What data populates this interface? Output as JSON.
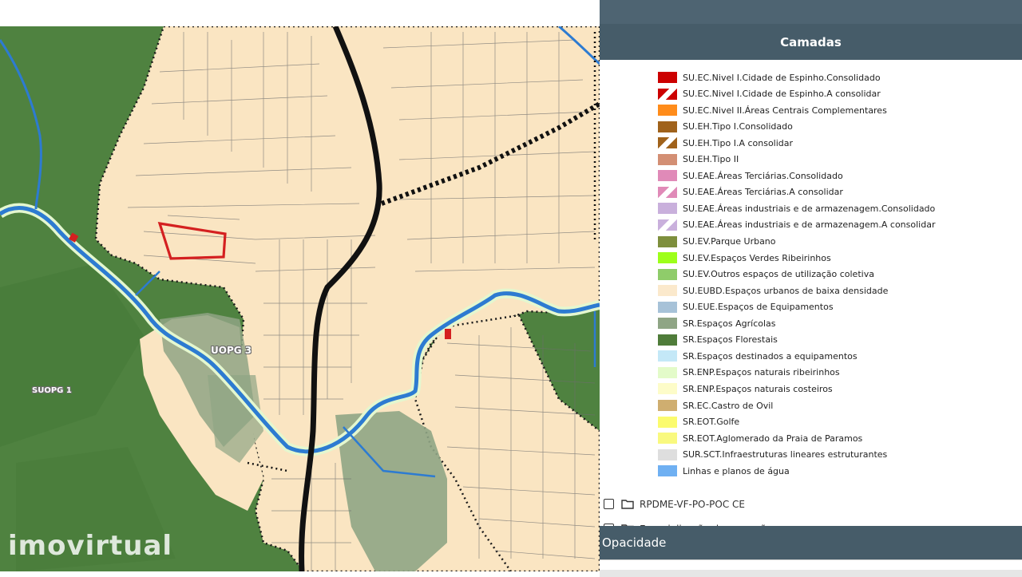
{
  "map": {
    "watermark": "imovirtual",
    "labels": {
      "uopg3": "UOPG 3",
      "suopg1": "SUOPG 1"
    }
  },
  "colors": {
    "green_forest": "#4f8240",
    "beige_urban": "#fae5c2",
    "light_green": "#8fa585",
    "water": "#2d7bd1",
    "parcel": "#d42020",
    "panel_header": "#465c69"
  },
  "panel": {
    "title": "Camadas",
    "legend": [
      {
        "label": "SU.EC.Nivel I.Cidade de Espinho.Consolidado",
        "color": "#cc0000",
        "hatch": false
      },
      {
        "label": "SU.EC.Nivel I.Cidade de Espinho.A consolidar",
        "color": "#cc0000",
        "hatch": true
      },
      {
        "label": "SU.EC.Nivel II.Áreas Centrais Complementares",
        "color": "#ff8c1a",
        "hatch": false
      },
      {
        "label": "SU.EH.Tipo I.Consolidado",
        "color": "#a0621b",
        "hatch": false
      },
      {
        "label": "SU.EH.Tipo I.A consolidar",
        "color": "#a0621b",
        "hatch": true
      },
      {
        "label": "SU.EH.Tipo II",
        "color": "#d38f74",
        "hatch": false
      },
      {
        "label": "SU.EAE.Áreas Terciárias.Consolidado",
        "color": "#e08ab8",
        "hatch": false
      },
      {
        "label": "SU.EAE.Áreas Terciárias.A consolidar",
        "color": "#e08ab8",
        "hatch": true
      },
      {
        "label": "SU.EAE.Áreas industriais e de armazenagem.Consolidado",
        "color": "#c9b0dc",
        "hatch": false
      },
      {
        "label": "SU.EAE.Áreas industriais e de armazenagem.A consolidar",
        "color": "#c9b0dc",
        "hatch": true
      },
      {
        "label": "SU.EV.Parque Urbano",
        "color": "#7e8f3d",
        "hatch": false
      },
      {
        "label": "SU.EV.Espaços Verdes Ribeirinhos",
        "color": "#9dff1a",
        "hatch": false
      },
      {
        "label": "SU.EV.Outros espaços de utilização coletiva",
        "color": "#8fcc6a",
        "hatch": false
      },
      {
        "label": "SU.EUBD.Espaços urbanos de baixa densidade",
        "color": "#fbe9cc",
        "hatch": false
      },
      {
        "label": "SU.EUE.Espaços de Equipamentos",
        "color": "#a7c2d8",
        "hatch": false
      },
      {
        "label": "SR.Espaços Agrícolas",
        "color": "#8fa585",
        "hatch": false
      },
      {
        "label": "SR.Espaços Florestais",
        "color": "#4f7c3a",
        "hatch": false
      },
      {
        "label": "SR.Espaços destinados a equipamentos",
        "color": "#c4e8f7",
        "hatch": false
      },
      {
        "label": "SR.ENP.Espaços naturais ribeirinhos",
        "color": "#e3fbc9",
        "hatch": false
      },
      {
        "label": "SR.ENP.Espaços naturais costeiros",
        "color": "#fdfcc9",
        "hatch": false
      },
      {
        "label": "SR.EC.Castro de Ovil",
        "color": "#cfae70",
        "hatch": false
      },
      {
        "label": "SR.EOT.Golfe",
        "color": "#fbfb6e",
        "hatch": false
      },
      {
        "label": "SR.EOT.Aglomerado da Praia de Paramos",
        "color": "#f9f97f",
        "hatch": false
      },
      {
        "label": "SUR.SCT.Infraestruturas lineares estruturantes",
        "color": "#dedede",
        "hatch": false
      },
      {
        "label": "Linhas e planos de água",
        "color": "#6fb0f2",
        "hatch": false
      }
    ],
    "groups": [
      {
        "label": "RPDME-VF-PO-POC CE"
      },
      {
        "label": "Espacialização das exceções"
      }
    ],
    "opacity_label": "Opacidade"
  }
}
